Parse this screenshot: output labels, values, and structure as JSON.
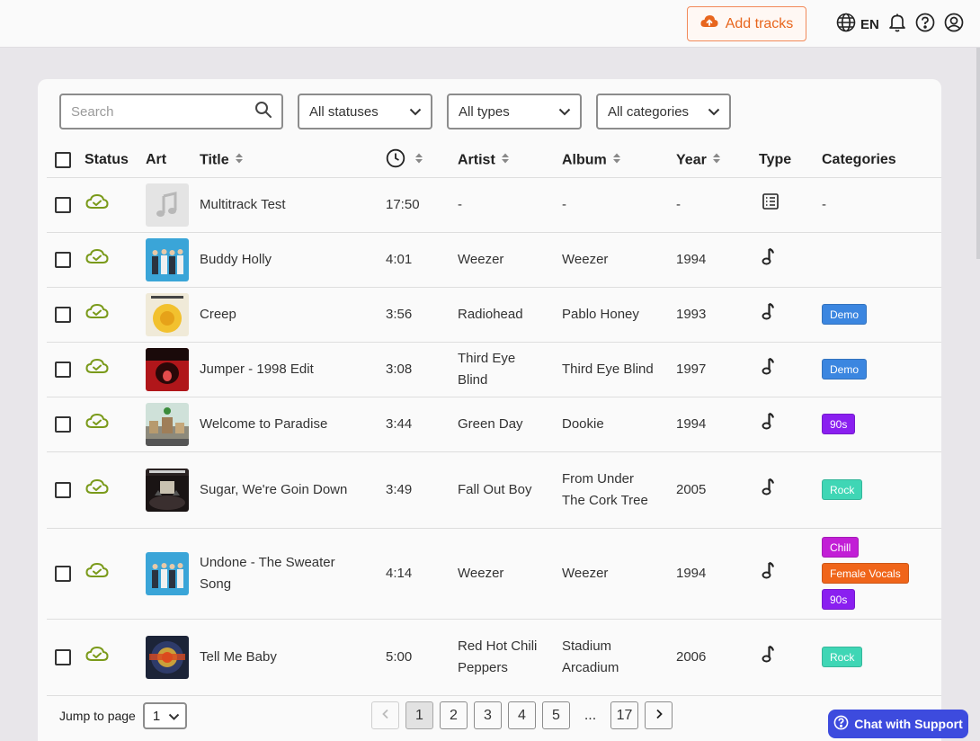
{
  "topbar": {
    "add_tracks_label": "Add tracks",
    "language": "EN"
  },
  "filters": {
    "search_placeholder": "Search",
    "status_label": "All statuses",
    "type_label": "All types",
    "category_label": "All categories"
  },
  "table": {
    "headers": {
      "status": "Status",
      "art": "Art",
      "title": "Title",
      "artist": "Artist",
      "album": "Album",
      "year": "Year",
      "type": "Type",
      "categories": "Categories"
    },
    "rows": [
      {
        "title": "Multitrack Test",
        "duration": "17:50",
        "artist": "-",
        "album": "-",
        "year": "-",
        "type_icon": "list-icon",
        "categories_text": "-",
        "categories": []
      },
      {
        "title": "Buddy Holly",
        "duration": "4:01",
        "artist": "Weezer",
        "album": "Weezer",
        "year": "1994",
        "type_icon": "music-note-icon",
        "categories": []
      },
      {
        "title": "Creep",
        "duration": "3:56",
        "artist": "Radiohead",
        "album": "Pablo Honey",
        "year": "1993",
        "type_icon": "music-note-icon",
        "categories": [
          {
            "label": "Demo",
            "color": "#3b86e0"
          }
        ]
      },
      {
        "title": "Jumper - 1998 Edit",
        "duration": "3:08",
        "artist": "Third Eye Blind",
        "album": "Third Eye Blind",
        "year": "1997",
        "type_icon": "music-note-icon",
        "categories": [
          {
            "label": "Demo",
            "color": "#3b86e0"
          }
        ]
      },
      {
        "title": "Welcome to Paradise",
        "duration": "3:44",
        "artist": "Green Day",
        "album": "Dookie",
        "year": "1994",
        "type_icon": "music-note-icon",
        "categories": [
          {
            "label": "90s",
            "color": "#8a1ff0"
          }
        ]
      },
      {
        "title": "Sugar, We're Goin Down",
        "duration": "3:49",
        "artist": "Fall Out Boy",
        "album": "From Under The Cork Tree",
        "year": "2005",
        "type_icon": "music-note-icon",
        "categories": [
          {
            "label": "Rock",
            "color": "#3fd6b5"
          }
        ]
      },
      {
        "title": "Undone - The Sweater Song",
        "duration": "4:14",
        "artist": "Weezer",
        "album": "Weezer",
        "year": "1994",
        "type_icon": "music-note-icon",
        "categories": [
          {
            "label": "Chill",
            "color": "#c21fd6"
          },
          {
            "label": "Female Vocals",
            "color": "#f0651a"
          },
          {
            "label": "90s",
            "color": "#8a1ff0"
          }
        ]
      },
      {
        "title": "Tell Me Baby",
        "duration": "5:00",
        "artist": "Red Hot Chili Peppers",
        "album": "Stadium Arcadium",
        "year": "2006",
        "type_icon": "music-note-icon",
        "categories": [
          {
            "label": "Rock",
            "color": "#3fd6b5"
          }
        ]
      }
    ]
  },
  "pagination": {
    "jump_label": "Jump to page",
    "jump_value": "1",
    "pages": [
      "1",
      "2",
      "3",
      "4",
      "5"
    ],
    "ellipsis": "...",
    "last_page": "17",
    "current_page": "1"
  },
  "chat": {
    "label": "Chat with Support"
  },
  "colors": {
    "accent": "#e8661e",
    "status_ok": "#7a9a1a",
    "chat": "#3d4bde"
  }
}
